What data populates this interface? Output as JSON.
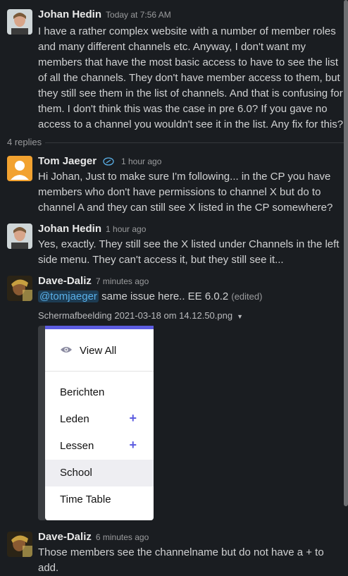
{
  "messages": [
    {
      "author": "Johan Hedin",
      "time": "Today at 7:56 AM",
      "text": "I have a rather complex website with a number of member roles and many different channels etc. Anyway, I don't want my members that have the most basic access to have to see the list of all the channels. They don't have member access to them, but they still see them in the list of channels. And that is confusing for them. I don't think this was the case in pre 6.0? If you gave no access to a channel you wouldn't see it in the list. Any fix for this?"
    },
    {
      "author": "Tom Jaeger",
      "time": "1 hour ago",
      "text": "Hi Johan,  Just to make sure I'm following... in the CP you have members who don't have permissions to channel X but do to channel A and they can still see X listed in the CP somewhere?"
    },
    {
      "author": "Johan Hedin",
      "time": "1 hour ago",
      "text": "Yes, exactly. They still see the X listed under Channels in the left side menu. They can't access it, but they still see it..."
    },
    {
      "author": "Dave-Daliz",
      "time": "7 minutes ago",
      "mention": "@tomjaeger",
      "text": " same issue here.. EE 6.0.2 ",
      "edited": "(edited)"
    },
    {
      "author": "Dave-Daliz",
      "time": "6 minutes ago",
      "text": "Those members see the channelname but do not have a + to add."
    }
  ],
  "thread": {
    "replies_label": "4 replies"
  },
  "attachment": {
    "filename": "Schermafbeelding 2021-03-18 om 14.12.50.png",
    "menu": {
      "view_all": "View All",
      "items": [
        {
          "label": "Berichten",
          "plus": ""
        },
        {
          "label": "Leden",
          "plus": "+"
        },
        {
          "label": "Lessen",
          "plus": "+"
        },
        {
          "label": "School",
          "plus": ""
        },
        {
          "label": "Time Table",
          "plus": ""
        }
      ]
    }
  },
  "colors": {
    "background": "#1a1d21",
    "mention_bg": "#1d3b52",
    "mention_text": "#5ab0e8",
    "menu_accent": "#5c5ce0"
  }
}
